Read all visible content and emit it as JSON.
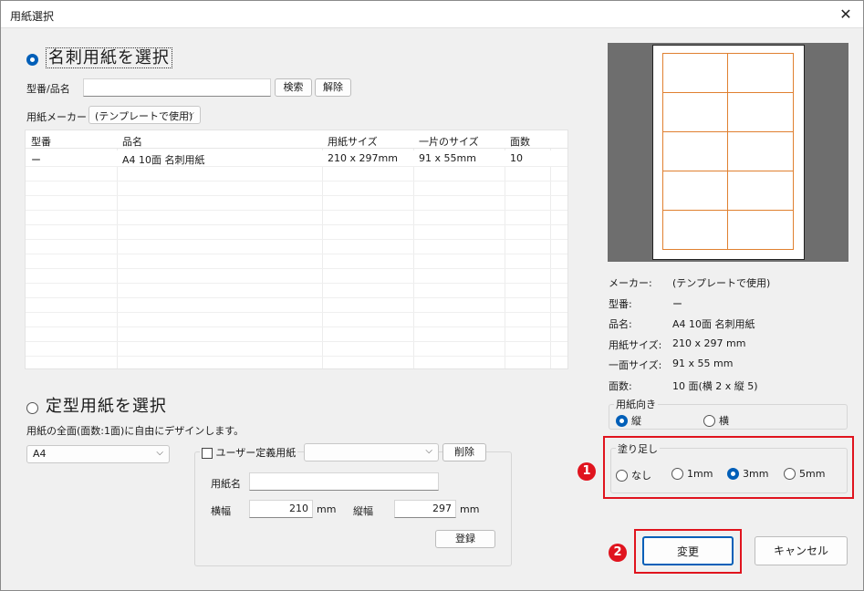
{
  "window": {
    "title": "用紙選択"
  },
  "meishi": {
    "label": "名刺用紙を選択",
    "search_label": "型番/品名",
    "search_value": "",
    "search_button": "検索",
    "clear_button": "解除",
    "maker_label": "用紙メーカー",
    "maker_value": "(テンプレートで使用)",
    "table": {
      "headers": [
        "型番",
        "品名",
        "用紙サイズ",
        "一片のサイズ",
        "面数"
      ],
      "rows": [
        [
          "ー",
          "A4 10面 名刺用紙",
          "210 x 297mm",
          "91 x 55mm",
          "10"
        ]
      ]
    }
  },
  "teikei": {
    "label": "定型用紙を選択",
    "description": "用紙の全面(面数:1面)に自由にデザインします。",
    "size_value": "A4",
    "user_paper_label": "ユーザー定義用紙",
    "user_paper_value": "",
    "delete_button": "削除",
    "name_label": "用紙名",
    "name_value": "",
    "width_label": "横幅",
    "width_value": "210",
    "width_unit": "mm",
    "height_label": "縦幅",
    "height_value": "297",
    "height_unit": "mm",
    "register_button": "登録"
  },
  "info": {
    "maker_key": "メーカー:",
    "maker_val": "(テンプレートで使用)",
    "model_key": "型番:",
    "model_val": "ー",
    "name_key": "品名:",
    "name_val": "A4 10面 名刺用紙",
    "size_key": "用紙サイズ:",
    "size_val": "210 x 297 mm",
    "piece_key": "一面サイズ:",
    "piece_val": "91 x 55 mm",
    "count_key": "面数:",
    "count_val": "10 面(横 2 x 縦 5)"
  },
  "orientation": {
    "title": "用紙向き",
    "portrait": "縦",
    "landscape": "横",
    "selected": "portrait"
  },
  "bleed": {
    "title": "塗り足し",
    "options": [
      "なし",
      "1mm",
      "3mm",
      "5mm"
    ],
    "selected": "3mm"
  },
  "buttons": {
    "change": "変更",
    "cancel": "キャンセル"
  },
  "badges": {
    "one": "1",
    "two": "2"
  },
  "colors": {
    "accent": "#005fb8",
    "highlight": "#e0141e",
    "card_outline": "#e08030"
  }
}
